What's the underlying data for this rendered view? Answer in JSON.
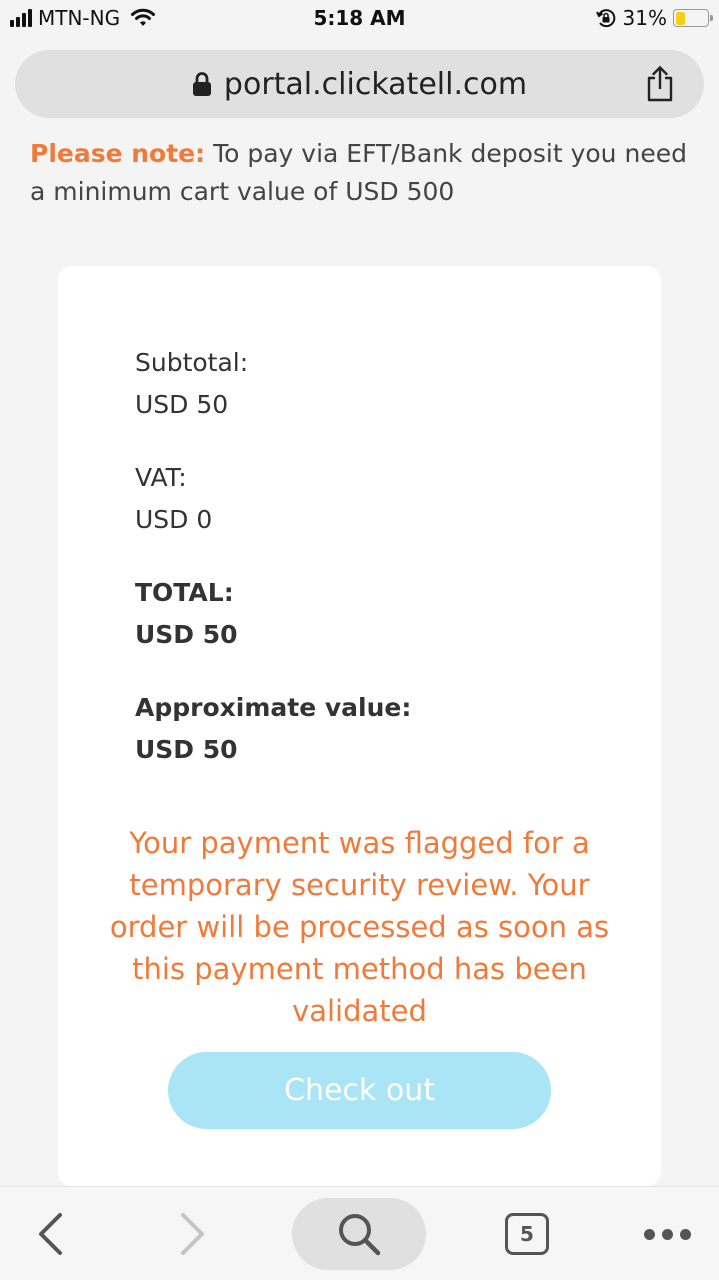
{
  "status_bar": {
    "carrier": "MTN-NG",
    "time": "5:18 AM",
    "battery_percent": "31%",
    "battery_level": 0.31,
    "icons": [
      "signal-icon",
      "wifi-icon",
      "orientation-lock-icon",
      "battery-icon"
    ]
  },
  "browser": {
    "url": "portal.clickatell.com",
    "lock_icon": "lock-icon",
    "share_icon": "share-icon"
  },
  "note": {
    "label": "Please note:",
    "text": " To pay via EFT/Bank deposit you need a minimum cart value of USD 500"
  },
  "summary": {
    "subtotal_label": "Subtotal:",
    "subtotal_value": "USD 50",
    "vat_label": "VAT:",
    "vat_value": "USD 0",
    "total_label": "TOTAL:",
    "total_value": "USD 50",
    "approx_label": "Approximate value:",
    "approx_value": "USD 50"
  },
  "warning": "Your payment was flagged for a temporary security review. Your order will be processed as soon as this payment method has been validated",
  "checkout_button": "Check out",
  "toolbar": {
    "tab_count": "5",
    "icons": [
      "back-icon",
      "forward-icon",
      "search-icon",
      "tabs-icon",
      "more-icon"
    ]
  },
  "colors": {
    "accent_orange": "#f07a3a",
    "button_blue": "#a9e5f5",
    "battery_yellow": "#f3cf1e"
  }
}
